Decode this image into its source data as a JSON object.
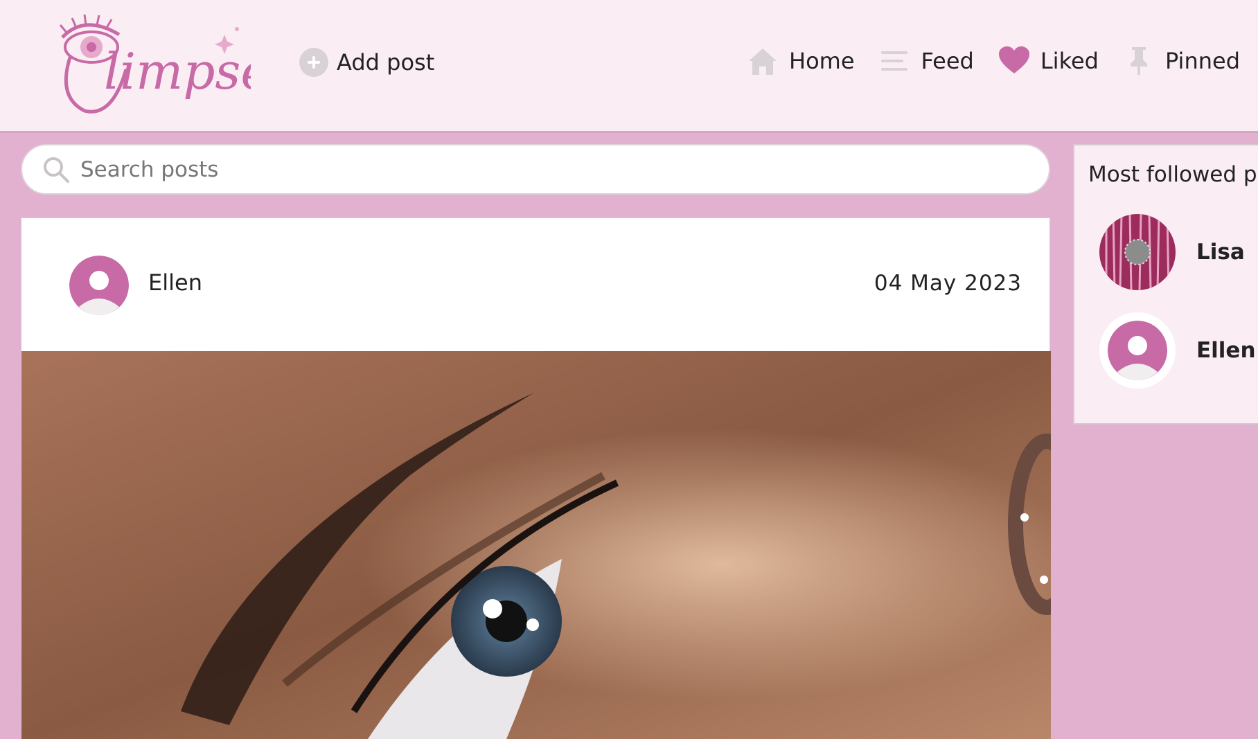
{
  "app": {
    "logo_text": "Glimpse",
    "brand_color": "#c76aa6",
    "background_color": "#e2b1cf"
  },
  "header": {
    "add_post_label": "Add post",
    "nav": [
      {
        "label": "Home",
        "icon": "home-icon"
      },
      {
        "label": "Feed",
        "icon": "feed-icon"
      },
      {
        "label": "Liked",
        "icon": "heart-icon"
      },
      {
        "label": "Pinned",
        "icon": "pin-icon"
      }
    ]
  },
  "search": {
    "placeholder": "Search posts",
    "value": ""
  },
  "post": {
    "author": "Ellen",
    "date": "04 May 2023",
    "image_description": "close-up photo of an eye with blue iris"
  },
  "sidebar": {
    "title": "Most followed p",
    "users": [
      {
        "name": "Lisa",
        "avatar": "photo"
      },
      {
        "name": "Ellen",
        "avatar": "default-user-icon"
      }
    ]
  }
}
